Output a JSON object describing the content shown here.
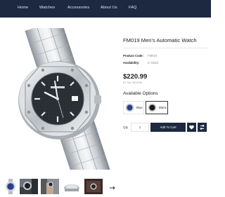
{
  "nav": {
    "items": [
      {
        "label": "Home"
      },
      {
        "label": "Watches"
      },
      {
        "label": "Accessories"
      },
      {
        "label": "About Us"
      },
      {
        "label": "FAQ"
      }
    ]
  },
  "product": {
    "title": "FM019 Men's Automatic Watch",
    "code_label": "Product Code:",
    "code_value": "FM019",
    "availability_label": "Availability:",
    "availability_value": "In Stock",
    "price": "$220.99",
    "ex_tax": "Ex Tax: $220.99"
  },
  "options": {
    "title": "Available Options",
    "swatches": [
      {
        "label": "Blue",
        "color": "#2a3f8a",
        "selected": false
      },
      {
        "label": "Black",
        "color": "#1a1a1a",
        "selected": true
      }
    ]
  },
  "cart": {
    "qty_label": "Qty",
    "qty_value": "1",
    "add_label": "Add To Cart"
  },
  "thumbnails": {
    "items": [
      {
        "name": "blue-watch"
      },
      {
        "name": "wrist-black"
      },
      {
        "name": "hand-watch"
      },
      {
        "name": "side-view"
      },
      {
        "name": "box"
      }
    ],
    "next_icon": "arrow-right-icon"
  },
  "colors": {
    "nav_bg": "#1c2940",
    "button_bg": "#1c2940"
  }
}
